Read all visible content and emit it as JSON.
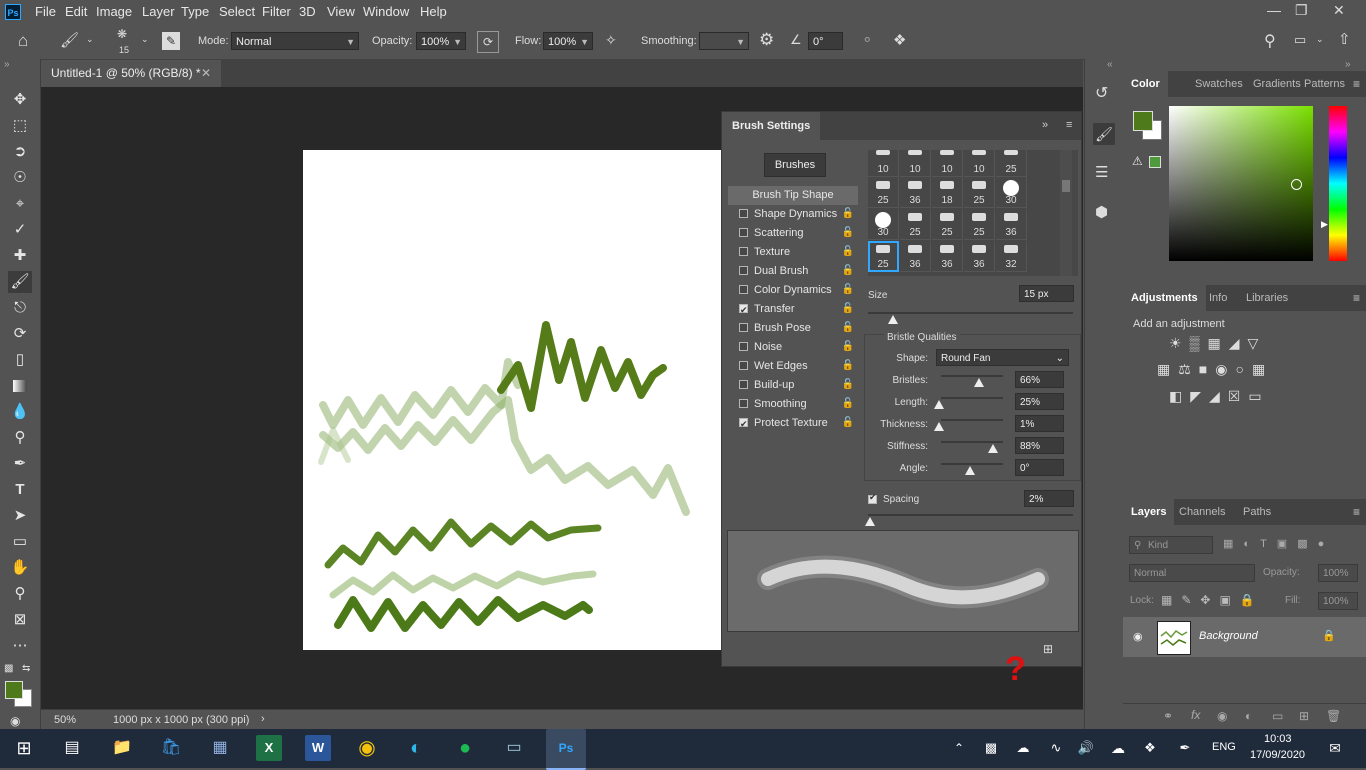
{
  "app": {
    "logo_text": "Ps",
    "menus": [
      "File",
      "Edit",
      "Image",
      "Layer",
      "Type",
      "Select",
      "Filter",
      "3D",
      "View",
      "Window",
      "Help"
    ]
  },
  "options_bar": {
    "brush_size": "15",
    "mode_label": "Mode:",
    "mode_value": "Normal",
    "opacity_label": "Opacity:",
    "opacity_value": "100%",
    "flow_label": "Flow:",
    "flow_value": "100%",
    "smoothing_label": "Smoothing:",
    "smoothing_value": "",
    "angle_value": "0°"
  },
  "document": {
    "tab_title": "Untitled-1 @ 50% (RGB/8) *",
    "zoom": "50%",
    "doc_info": "1000 px x 1000 px (300 ppi)"
  },
  "brush_settings": {
    "title": "Brush Settings",
    "brushes_button": "Brushes",
    "tip_shape_label": "Brush Tip Shape",
    "options": [
      {
        "label": "Shape Dynamics",
        "checked": false
      },
      {
        "label": "Scattering",
        "checked": false
      },
      {
        "label": "Texture",
        "checked": false
      },
      {
        "label": "Dual Brush",
        "checked": false
      },
      {
        "label": "Color Dynamics",
        "checked": false
      },
      {
        "label": "Transfer",
        "checked": true
      },
      {
        "label": "Brush Pose",
        "checked": false
      },
      {
        "label": "Noise",
        "checked": false
      },
      {
        "label": "Wet Edges",
        "checked": false
      },
      {
        "label": "Build-up",
        "checked": false
      },
      {
        "label": "Smoothing",
        "checked": false
      },
      {
        "label": "Protect Texture",
        "checked": true
      }
    ],
    "tip_sizes": [
      [
        "10",
        "10",
        "10",
        "10",
        "25"
      ],
      [
        "25",
        "36",
        "18",
        "25",
        "30"
      ],
      [
        "30",
        "25",
        "25",
        "25",
        "36"
      ],
      [
        "25",
        "36",
        "36",
        "36",
        "32"
      ]
    ],
    "size_label": "Size",
    "size_value": "15 px",
    "bristle_title": "Bristle Qualities",
    "shape_label": "Shape:",
    "shape_value": "Round Fan",
    "bristles_label": "Bristles:",
    "bristles_value": "66%",
    "length_label": "Length:",
    "length_value": "25%",
    "thickness_label": "Thickness:",
    "thickness_value": "1%",
    "stiffness_label": "Stiffness:",
    "stiffness_value": "88%",
    "angle_label": "Angle:",
    "angle_value": "0°",
    "spacing_label": "Spacing",
    "spacing_value": "2%",
    "spacing_checked": true
  },
  "color_panel": {
    "tabs": [
      "Color",
      "Swatches",
      "Gradients",
      "Patterns"
    ],
    "foreground": "#4f7a1c",
    "background": "#ffffff",
    "hue_color": "#7ae000"
  },
  "adjustments_panel": {
    "tabs": [
      "Adjustments",
      "Info",
      "Libraries"
    ],
    "hint": "Add an adjustment"
  },
  "layers_panel": {
    "tabs": [
      "Layers",
      "Channels",
      "Paths"
    ],
    "filter_placeholder": "Kind",
    "blend_mode": "Normal",
    "opacity_label": "Opacity:",
    "opacity_value": "100%",
    "lock_label": "Lock:",
    "fill_label": "Fill:",
    "fill_value": "100%",
    "layer_name": "Background"
  },
  "taskbar": {
    "language": "ENG",
    "time": "10:03",
    "date": "17/09/2020"
  },
  "help_marker": "?"
}
